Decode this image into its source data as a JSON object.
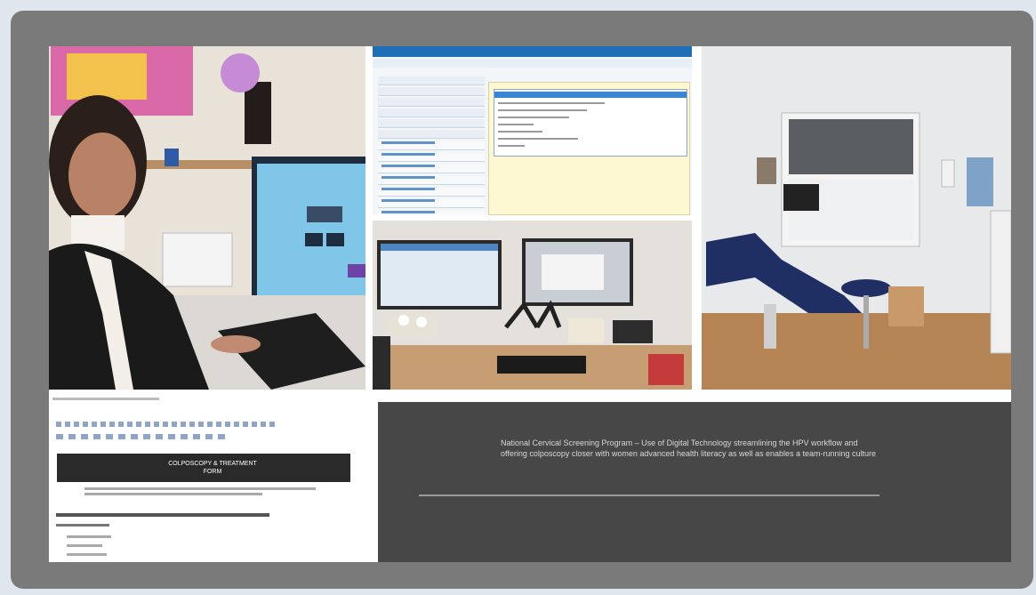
{
  "collage": {
    "tiles": [
      {
        "id": "clinician-photo",
        "description_label": ""
      },
      {
        "id": "software-screenshot"
      },
      {
        "id": "dual-monitor-desk-photo"
      },
      {
        "id": "clinic-room-photo"
      },
      {
        "id": "colposcopy-form-screenshot"
      },
      {
        "id": "caption-panel"
      }
    ]
  },
  "caption": {
    "text": "National Cervical Screening Program – Use of Digital Technology streamlining the HPV workflow and offering colposcopy closer with women advanced health literacy as well as enables a team-running culture"
  },
  "form": {
    "banner_title": "COLPOSCOPY & TREATMENT FORM"
  },
  "colors": {
    "page_bg": "#dfe6ee",
    "frame": "#7a7a7a",
    "caption_panel": "#474747",
    "app_header": "#1f6fb6",
    "highlight_pane": "#fdf8d2"
  }
}
